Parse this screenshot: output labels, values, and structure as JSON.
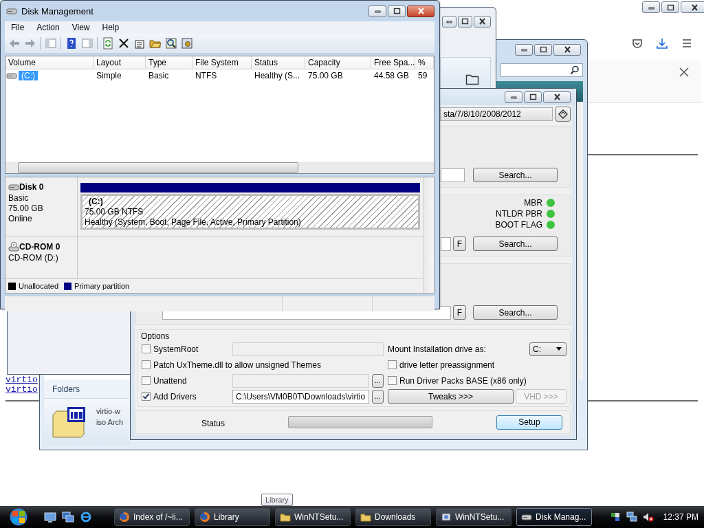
{
  "browser_window": {
    "links": [
      "virtio",
      "virtio"
    ]
  },
  "downloads_window": {
    "pane_label": "Folders",
    "file": {
      "name": "virtio-w",
      "type": "iso Arch"
    }
  },
  "winntsetup_window": {
    "source_path": "sta/7/8/10/2008/2012",
    "sections": [
      {
        "search_button": "Search..."
      },
      {
        "f_button": "F",
        "search_button": "Search...",
        "indicators": [
          {
            "label": "MBR",
            "ok": true
          },
          {
            "label": "NTLDR PBR",
            "ok": true
          },
          {
            "label": "BOOT FLAG",
            "ok": true
          }
        ]
      },
      {
        "f_button": "F",
        "search_button": "Search..."
      }
    ],
    "options": {
      "title": "Options",
      "rows": [
        {
          "checkbox": {
            "label": "SystemRoot",
            "checked": false
          },
          "field": {
            "disabled": true
          },
          "right": {
            "kind": "dropdown",
            "label": "Mount Installation drive as:",
            "value": "C:"
          }
        },
        {
          "checkbox": {
            "label": "Patch UxTheme.dll to allow unsigned Themes",
            "checked": false
          },
          "right": {
            "kind": "checkbox",
            "label": "drive letter preassignment",
            "checked": false
          }
        },
        {
          "checkbox": {
            "label": "Unattend",
            "checked": false
          },
          "field": {
            "disabled": true
          },
          "browse_button": "...",
          "right": {
            "kind": "checkbox",
            "label": "Run Driver Packs BASE (x86 only)",
            "checked": false
          }
        },
        {
          "checkbox": {
            "label": "Add Drivers",
            "checked": true
          },
          "field": {
            "value": "C:\\Users\\VM0B0T\\Downloads\\virtio",
            "disabled": false
          },
          "browse_button": "...",
          "right": {
            "kind": "buttons",
            "buttons": [
              {
                "label": "Tweaks >>>",
                "disabled": false
              },
              {
                "label": "VHD >>>",
                "disabled": true
              }
            ]
          }
        }
      ]
    },
    "status": {
      "label": "Status",
      "level": 0
    },
    "setup_button": "Setup"
  },
  "disk_management": {
    "title": "Disk Management",
    "menu": [
      "File",
      "Action",
      "View",
      "Help"
    ],
    "columns": [
      "Volume",
      "Layout",
      "Type",
      "File System",
      "Status",
      "Capacity",
      "Free Spa...",
      "%"
    ],
    "rows": [
      {
        "cells": [
          "(C:)",
          "Simple",
          "Basic",
          "NTFS",
          "Healthy (S...",
          "75.00 GB",
          "44.58 GB",
          "59"
        ],
        "selected": true
      }
    ],
    "disks": [
      {
        "kind": "disk",
        "name": "Disk 0",
        "details": [
          "Basic",
          "75.00 GB",
          "Online"
        ],
        "partitions": [
          {
            "name": "(C:)",
            "size": "75.00 GB NTFS",
            "status": "Healthy (System, Boot, Page File, Active, Primary Partition)",
            "color": "#000080"
          }
        ]
      },
      {
        "kind": "cdrom",
        "name": "CD-ROM 0",
        "details": [
          "CD-ROM (D:)"
        ]
      }
    ],
    "legend": [
      {
        "label": "Unallocated",
        "color": "#000000"
      },
      {
        "label": "Primary partition",
        "color": "#000080"
      }
    ]
  },
  "taskbar": {
    "tooltip": "Library",
    "items": [
      {
        "kind": "browser",
        "label": "Index of /~li...",
        "selected": false
      },
      {
        "kind": "browser",
        "label": "Library",
        "selected": false
      },
      {
        "kind": "folder",
        "label": "WinNTSetu...",
        "selected": false
      },
      {
        "kind": "folder",
        "label": "Downloads",
        "selected": false
      },
      {
        "kind": "setup",
        "label": "WinNTSetu...",
        "selected": false
      },
      {
        "kind": "disk",
        "label": "Disk Manag...",
        "selected": true
      }
    ],
    "clock": "12:37 PM"
  }
}
